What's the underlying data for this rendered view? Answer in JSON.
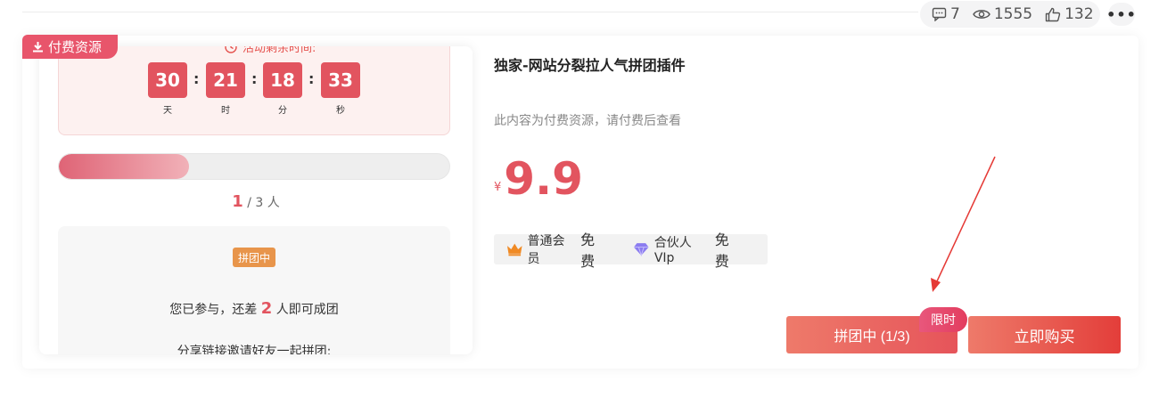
{
  "stats": {
    "comments": "7",
    "views": "1555",
    "likes": "132",
    "more": "•••"
  },
  "paid_tag": "付费资源",
  "countdown": {
    "title": "活动剩余时间:",
    "items": [
      {
        "value": "30",
        "unit": "天"
      },
      {
        "value": "21",
        "unit": "时"
      },
      {
        "value": "18",
        "unit": "分"
      },
      {
        "value": "33",
        "unit": "秒"
      }
    ],
    "separator": ":"
  },
  "progress": {
    "fraction": 0.333,
    "joined": "1",
    "total_text": "/ 3 人"
  },
  "group": {
    "status": "拼团中",
    "joined_prefix": "您已参与，还差",
    "remaining": "2",
    "joined_suffix": "人即可成团",
    "share_text": "分享链接邀请好友一起拼团:"
  },
  "product": {
    "title": "独家-网站分裂拉人气拼团插件",
    "desc": "此内容为付费资源，请付费后查看",
    "currency": "¥",
    "price": "9.9"
  },
  "members": [
    {
      "name": "普通会员",
      "price": "免费",
      "icon": "crown-icon",
      "color": "#f08a24"
    },
    {
      "name": "合伙人VIp",
      "price": "免费",
      "icon": "diamond-icon",
      "color": "#8b7cf0"
    }
  ],
  "buttons": {
    "group": "拼团中 (1/3)",
    "buy": "立即购买",
    "limit_badge": "限时"
  },
  "colors": {
    "accent": "#e2545f",
    "annotation_arrow": "#e53935"
  }
}
